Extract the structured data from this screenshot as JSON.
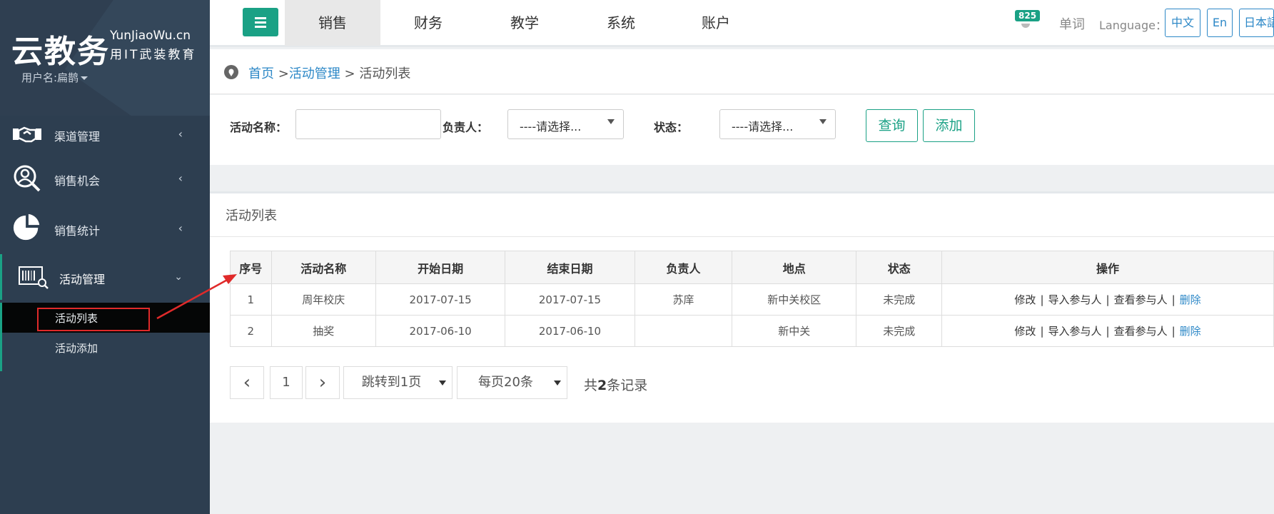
{
  "sidebar": {
    "logo_main": "云教务",
    "logo_en": "YunJiaoWu.cn",
    "logo_sub": "用IT武装教育",
    "user_label": "用户名:扁鹊",
    "items": [
      {
        "label": "渠道管理",
        "icon": "handshake-icon"
      },
      {
        "label": "销售机会",
        "icon": "person-search-icon"
      },
      {
        "label": "销售统计",
        "icon": "pie-chart-icon"
      },
      {
        "label": "活动管理",
        "icon": "barcode-scan-icon"
      }
    ],
    "submenu": [
      {
        "label": "活动列表"
      },
      {
        "label": "活动添加"
      }
    ]
  },
  "topnav": {
    "tabs": [
      "销售",
      "财务",
      "教学",
      "系统",
      "账户"
    ],
    "active_tab": "销售",
    "badge_count": "825",
    "words_label": "单词",
    "language_label": "Language：",
    "languages": [
      "中文",
      "En",
      "日本語"
    ]
  },
  "breadcrumb": {
    "home": "首页",
    "sep1": " >",
    "level1": "活动管理",
    "sep2": " > ",
    "current": "活动列表"
  },
  "filter": {
    "name_label": "活动名称：",
    "name_value": "",
    "owner_label": "负责人：",
    "owner_selected": "----请选择...",
    "status_label": "状态：",
    "status_selected": "----请选择...",
    "query_btn": "查询",
    "add_btn": "添加"
  },
  "list": {
    "title": "活动列表",
    "columns": [
      "序号",
      "活动名称",
      "开始日期",
      "结束日期",
      "负责人",
      "地点",
      "状态",
      "操作"
    ],
    "rows": [
      {
        "no": "1",
        "name": "周年校庆",
        "start": "2017-07-15",
        "end": "2017-07-15",
        "owner": "苏庠",
        "place": "新中关校区",
        "status": "未完成"
      },
      {
        "no": "2",
        "name": "抽奖",
        "start": "2017-06-10",
        "end": "2017-06-10",
        "owner": "",
        "place": "新中关",
        "status": "未完成"
      }
    ],
    "ops": {
      "edit": "修改",
      "import": "导入参与人",
      "view": "查看参与人",
      "delete": "删除",
      "sep": "|"
    }
  },
  "pagination": {
    "prev": "‹",
    "current_page": "1",
    "next": "›",
    "jump_label": "跳转到1页",
    "per_page_label": "每页20条",
    "total_prefix": "共",
    "total_count": "2",
    "total_suffix": "条记录"
  },
  "colors": {
    "accent": "#1aa185",
    "link": "#2d88c7",
    "sidebar_bg": "#2d3e50",
    "annotation": "#e02a2a"
  }
}
